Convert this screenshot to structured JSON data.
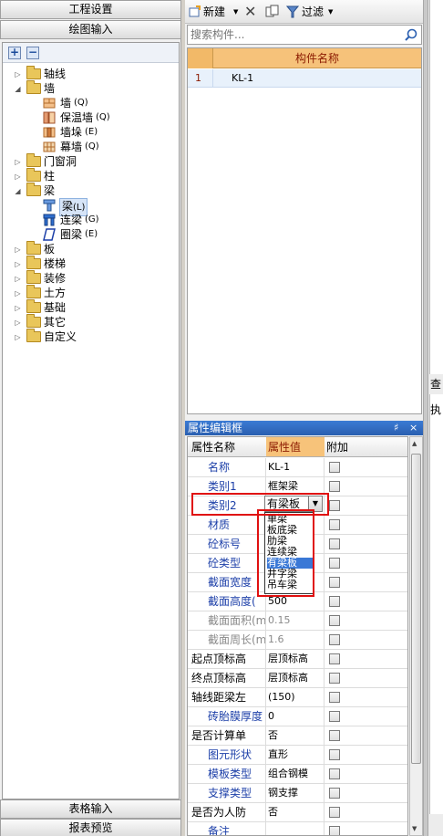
{
  "left": {
    "top_buttons": [
      "工程设置",
      "绘图输入"
    ],
    "bottom_buttons": [
      "表格输入",
      "报表预览"
    ],
    "toolbar": {
      "add": "+",
      "remove": "−"
    },
    "tree": [
      {
        "label": "轴线",
        "code": ""
      },
      {
        "label": "墙",
        "code": ""
      },
      {
        "label": "墙",
        "code": "(Q)"
      },
      {
        "label": "保温墙",
        "code": "(Q)"
      },
      {
        "label": "墙垛",
        "code": "(E)"
      },
      {
        "label": "幕墙",
        "code": "(Q)"
      },
      {
        "label": "门窗洞",
        "code": ""
      },
      {
        "label": "柱",
        "code": ""
      },
      {
        "label": "梁",
        "code": ""
      },
      {
        "label": "梁",
        "code": "(L)"
      },
      {
        "label": "连梁",
        "code": "(G)"
      },
      {
        "label": "圈梁",
        "code": "(E)"
      },
      {
        "label": "板",
        "code": ""
      },
      {
        "label": "楼梯",
        "code": ""
      },
      {
        "label": "装修",
        "code": ""
      },
      {
        "label": "土方",
        "code": ""
      },
      {
        "label": "基础",
        "code": ""
      },
      {
        "label": "其它",
        "code": ""
      },
      {
        "label": "自定义",
        "code": ""
      }
    ]
  },
  "middle": {
    "toolbar": {
      "new_label": "新建",
      "filter_label": "过滤"
    },
    "search": {
      "placeholder": "搜索构件..."
    },
    "grid": {
      "header": "构件名称",
      "rows": [
        {
          "num": "1",
          "name": "KL-1"
        }
      ]
    },
    "properties": {
      "title": "属性编辑框",
      "pin": "♯",
      "close": "×",
      "headers": {
        "name": "属性名称",
        "value": "属性值",
        "extra": "附加"
      },
      "rows": [
        {
          "name": "名称",
          "value": "KL-1"
        },
        {
          "name": "类别1",
          "value": "框架梁"
        },
        {
          "name": "类别2",
          "value": "有梁板"
        },
        {
          "name": "材质",
          "value": ""
        },
        {
          "name": "砼标号",
          "value": ""
        },
        {
          "name": "砼类型",
          "value": ""
        },
        {
          "name": "截面宽度",
          "value": ""
        },
        {
          "name": "截面高度(",
          "value": "500"
        },
        {
          "name": "截面面积(m",
          "value": "0.15"
        },
        {
          "name": "截面周长(m",
          "value": "1.6"
        },
        {
          "name": "起点顶标高",
          "value": "层顶标高"
        },
        {
          "name": "终点顶标高",
          "value": "层顶标高"
        },
        {
          "name": "轴线距梁左",
          "value": "(150)"
        },
        {
          "name": "砖胎膜厚度",
          "value": "0"
        },
        {
          "name": "是否计算单",
          "value": "否"
        },
        {
          "name": "图元形状",
          "value": "直形"
        },
        {
          "name": "模板类型",
          "value": "组合钢模"
        },
        {
          "name": "支撑类型",
          "value": "钢支撑"
        },
        {
          "name": "是否为人防",
          "value": "否"
        },
        {
          "name": "备注",
          "value": ""
        }
      ],
      "dropdown_options": [
        "单梁",
        "板底梁",
        "肋梁",
        "连续梁",
        "有梁板",
        "井字梁",
        "吊车梁"
      ],
      "dropdown_selected": "有梁板"
    }
  },
  "right": {
    "label_top": "查",
    "label_2": "执"
  },
  "colors": {
    "highlight": "#e01010",
    "header_orange": "#f6c27a",
    "selected_blue": "#3a78d6"
  }
}
